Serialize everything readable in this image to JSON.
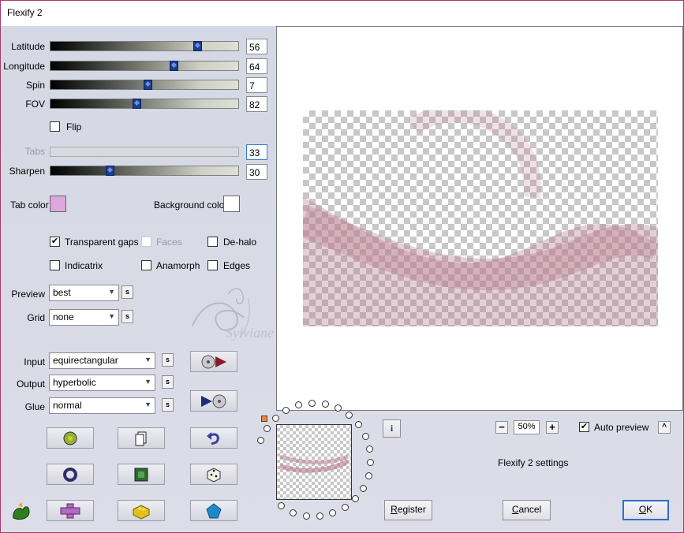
{
  "window": {
    "title": "Flexify 2"
  },
  "sliders": [
    {
      "label": "Latitude",
      "value": "56",
      "fraction": 0.8
    },
    {
      "label": "Longitude",
      "value": "64",
      "fraction": 0.67
    },
    {
      "label": "Spin",
      "value": "7",
      "fraction": 0.52
    },
    {
      "label": "FOV",
      "value": "82",
      "fraction": 0.46
    },
    {
      "label": "Tabs",
      "value": "33",
      "fraction": 0,
      "disabled": true
    },
    {
      "label": "Sharpen",
      "value": "30",
      "fraction": 0.31
    }
  ],
  "flip": {
    "label": "Flip",
    "checked": false
  },
  "colors": {
    "tab_label": "Tab color",
    "tab_color": "#dba7dc",
    "background_label": "Background color",
    "background_color": "#ffffff",
    "accent": "#2f6fc5",
    "preview_tint": "#b7788c"
  },
  "options": {
    "transparent_gaps": {
      "label": "Transparent gaps",
      "checked": true
    },
    "faces": {
      "label": "Faces",
      "checked": false,
      "disabled": true
    },
    "de_halo": {
      "label": "De-halo",
      "checked": false
    },
    "indicatrix": {
      "label": "Indicatrix",
      "checked": false
    },
    "anamorph": {
      "label": "Anamorph",
      "checked": false
    },
    "edges": {
      "label": "Edges",
      "checked": false
    }
  },
  "preview": {
    "label": "Preview",
    "value": "best",
    "s": "s"
  },
  "grid": {
    "label": "Grid",
    "value": "none",
    "s": "s"
  },
  "projection": {
    "input_label": "Input",
    "input_value": "equirectangular",
    "output_label": "Output",
    "output_value": "hyperbolic",
    "glue_label": "Glue",
    "glue_value": "normal",
    "s": "s"
  },
  "watermark": "Sylviane",
  "zoom": {
    "value": "50%",
    "minus": "−",
    "plus": "+"
  },
  "auto_preview": {
    "label": "Auto preview",
    "checked": true,
    "collapse": "^"
  },
  "settings_title": "Flexify 2 settings",
  "info": "i",
  "buttons": {
    "register_prefix": "R",
    "register_rest": "egister",
    "cancel_prefix": "C",
    "cancel_rest": "ancel",
    "ok_prefix": "O",
    "ok_rest": "K"
  },
  "icons": [
    "play-to-disc-icon",
    "disc-to-play-icon",
    "randomize-icon",
    "copy-icon",
    "undo-icon",
    "ring-icon",
    "chip-icon",
    "dice-icon",
    "logo-icon",
    "cross-icon",
    "brick-icon",
    "gem-icon"
  ]
}
